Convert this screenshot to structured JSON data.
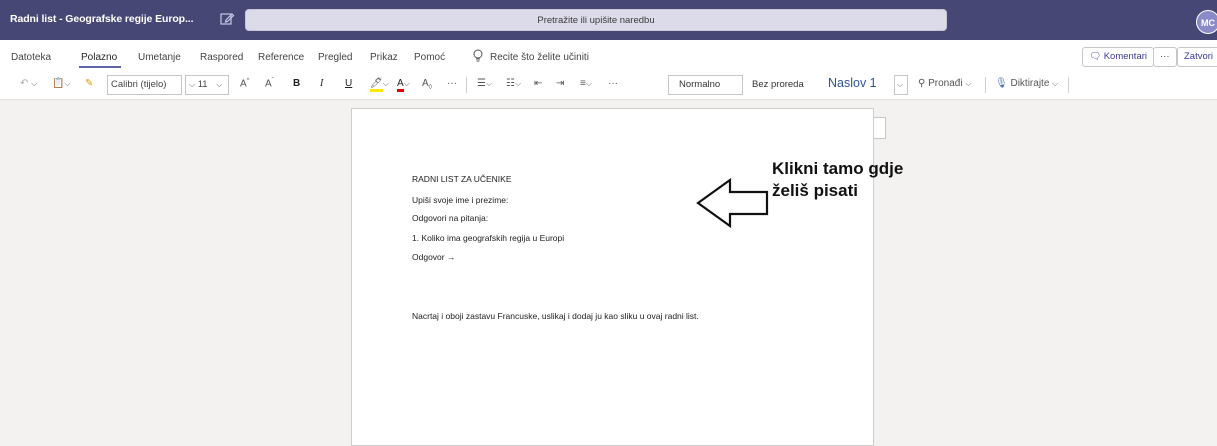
{
  "titlebar": {
    "app_title": "Radni list - Geografske regije Europ...",
    "search_placeholder": "Pretražite ili upišite naredbu",
    "avatar_initials": "MC"
  },
  "menu": {
    "items": [
      "Datoteka",
      "Polazno",
      "Umetanje",
      "Raspored",
      "Reference",
      "Pregled",
      "Prikaz",
      "Pomoć"
    ],
    "active": "Polazno",
    "tell_me": "Recite što želite učiniti",
    "comments_label": "Komentari",
    "more_label": "···",
    "close_label": "Zatvori"
  },
  "toolbar": {
    "font_name": "Calibri (tijelo)",
    "font_size": "11",
    "styles": {
      "normal": "Normalno",
      "no_spacing": "Bez proreda",
      "heading1": "Naslov 1"
    },
    "find_label": "Pronađi",
    "dictate_label": "Diktirajte",
    "more": "···"
  },
  "document": {
    "lines": [
      "RADNI LIST ZA UČENIKE",
      "Upiši svoje ime i prezime:",
      "Odgovori na pitanja:",
      "1. Koliko ima geografskih regija u Europi",
      "Odgovor →",
      "Nacrtaj i oboji zastavu Francuske, uslikaj i dodaj ju kao sliku u ovaj radni list."
    ]
  },
  "annotation": {
    "line1": "Klikni tamo gdje",
    "line2": "želiš pisati"
  },
  "colors": {
    "titlebar": "#464775",
    "accent": "#6264a7",
    "heading": "#2f5496"
  }
}
